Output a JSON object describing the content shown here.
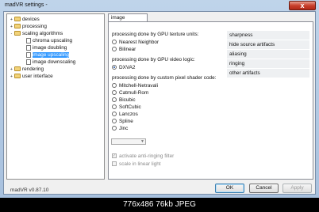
{
  "window": {
    "title": "madVR settings -",
    "close_glyph": "x"
  },
  "tree": {
    "items": [
      {
        "label": "devices",
        "icon": "folder-icon",
        "expander": "+"
      },
      {
        "label": "processing",
        "icon": "folder-icon",
        "expander": "+"
      },
      {
        "label": "scaling algorithms",
        "icon": "folder-icon",
        "expander": "-"
      },
      {
        "label": "chroma upscaling",
        "icon": "page-icon",
        "expander": ""
      },
      {
        "label": "image doubling",
        "icon": "page-icon",
        "expander": ""
      },
      {
        "label": "image upscaling",
        "icon": "page-icon",
        "expander": "",
        "selected": true
      },
      {
        "label": "image downscaling",
        "icon": "page-icon",
        "expander": ""
      },
      {
        "label": "rendering",
        "icon": "folder-icon",
        "expander": "+"
      },
      {
        "label": "user interface",
        "icon": "folder-icon",
        "expander": "+"
      }
    ]
  },
  "version": "madVR v0.87.10",
  "tab": {
    "label": "image upscaling"
  },
  "sections": {
    "texture_units": "processing done by GPU texture units:",
    "video_logic": "processing done by GPU video logic:",
    "pixel_shader": "processing done by custom pixel shader code:"
  },
  "texture_options": [
    {
      "label": "Nearest Neighbor",
      "checked": false
    },
    {
      "label": "Bilinear",
      "checked": false
    }
  ],
  "video_logic_options": [
    {
      "label": "DXVA2",
      "checked": true
    }
  ],
  "shader_options": [
    {
      "label": "Mitchell-Netravali",
      "checked": false
    },
    {
      "label": "Catmull-Rom",
      "checked": false
    },
    {
      "label": "Bicubic",
      "checked": false
    },
    {
      "label": "SoftCubic",
      "checked": false
    },
    {
      "label": "Lanczos",
      "checked": false
    },
    {
      "label": "Spline",
      "checked": false
    },
    {
      "label": "Jinc",
      "checked": false
    }
  ],
  "checkboxes": {
    "anti_ringing": {
      "label": "activate anti-ringing filter",
      "checked": true,
      "disabled": true
    },
    "linear_light": {
      "label": "scale in linear light",
      "checked": false,
      "disabled": true
    }
  },
  "quality_list": [
    "sharpness",
    "hide source artifacts",
    "aliasing",
    "ringing",
    "other artifacts"
  ],
  "buttons": {
    "ok": "OK",
    "cancel": "Cancel",
    "apply": "Apply"
  },
  "caption": "776x486  76kb  JPEG",
  "colors": {
    "selection": "#3399ff",
    "close": "#c8402c",
    "frame": "#a8c1de"
  }
}
